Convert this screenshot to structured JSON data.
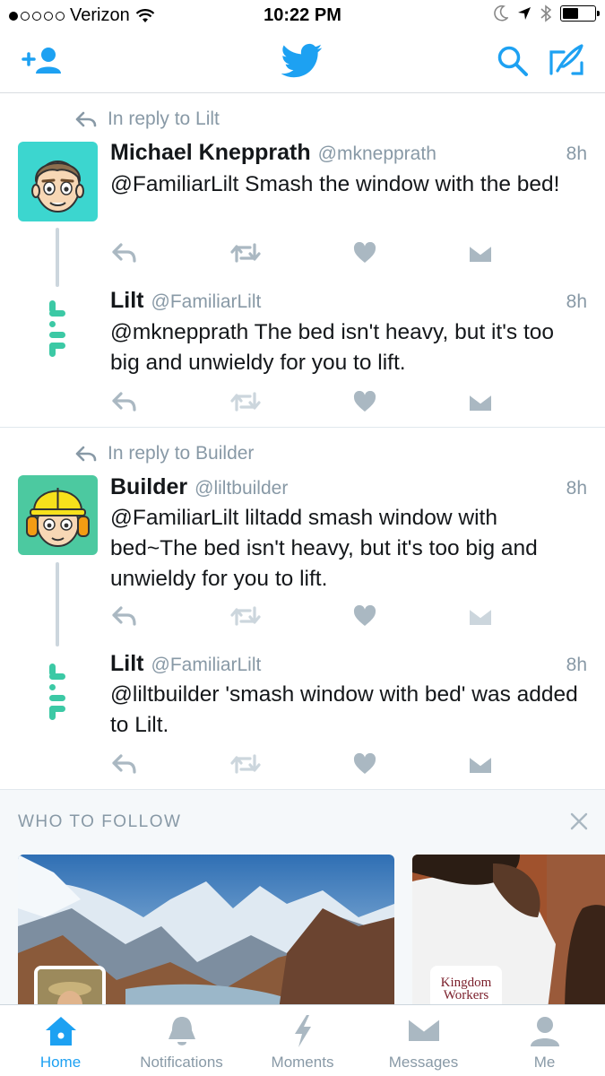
{
  "status_bar": {
    "carrier": "Verizon",
    "time": "10:22 PM"
  },
  "threads": [
    {
      "reply_to": "In reply to Lilt",
      "tweets": [
        {
          "name": "Michael Knepprath",
          "handle": "@mknepprath",
          "time": "8h",
          "text": "@FamiliarLilt Smash the window with the bed!"
        },
        {
          "name": "Lilt",
          "handle": "@FamiliarLilt",
          "time": "8h",
          "text": "@mknepprath The bed isn't heavy, but it's too big and unwieldy for you to lift."
        }
      ]
    },
    {
      "reply_to": "In reply to Builder",
      "tweets": [
        {
          "name": "Builder",
          "handle": "@liltbuilder",
          "time": "8h",
          "text": "@FamiliarLilt liltadd smash window with bed~The bed isn't heavy, but it's too big and unwieldy for you to lift."
        },
        {
          "name": "Lilt",
          "handle": "@FamiliarLilt",
          "time": "8h",
          "text": "@liltbuilder 'smash window with bed' was added to Lilt."
        }
      ]
    }
  ],
  "who_to_follow": {
    "title": "WHO TO FOLLOW",
    "card2_logo_text": "Kingdom Workers"
  },
  "tabs": [
    {
      "label": "Home",
      "icon": "home-icon",
      "active": true
    },
    {
      "label": "Notifications",
      "icon": "bell-icon",
      "active": false
    },
    {
      "label": "Moments",
      "icon": "lightning-icon",
      "active": false
    },
    {
      "label": "Messages",
      "icon": "envelope-icon",
      "active": false
    },
    {
      "label": "Me",
      "icon": "person-icon",
      "active": false
    }
  ],
  "colors": {
    "accent": "#1da1f2",
    "muted": "#8899a6",
    "action_icon": "#aab8c2",
    "lilt_teal": "#3cc9a5"
  }
}
